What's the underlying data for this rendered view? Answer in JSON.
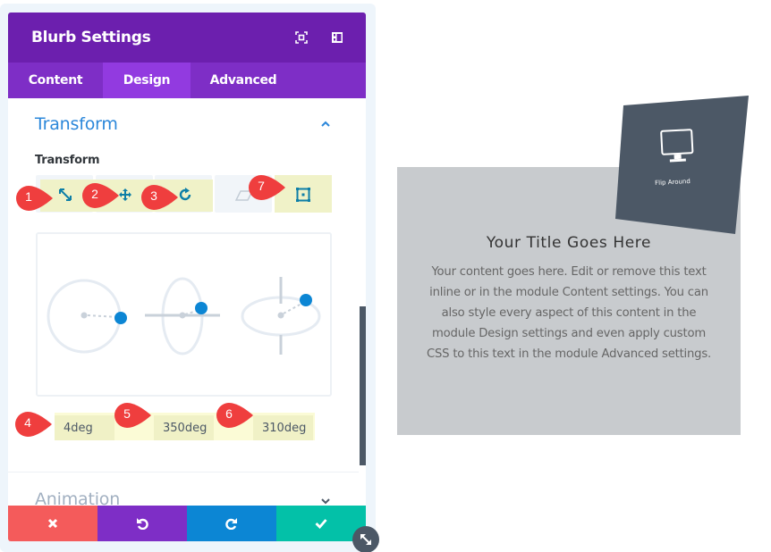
{
  "modal": {
    "title": "Blurb Settings",
    "header_icons": [
      "fullscreen-icon",
      "sidebar-layout-icon"
    ],
    "tabs": [
      {
        "label": "Content",
        "active": false
      },
      {
        "label": "Design",
        "active": true
      },
      {
        "label": "Advanced",
        "active": false
      }
    ],
    "section": {
      "title": "Transform",
      "expanded": true,
      "field_label": "Transform",
      "transform_types": [
        {
          "name": "scale",
          "icon": "scale-arrows-icon",
          "active": true
        },
        {
          "name": "translate",
          "icon": "move-arrows-icon",
          "active": true
        },
        {
          "name": "rotate",
          "icon": "rotate-icon",
          "active": true
        },
        {
          "name": "skew",
          "icon": "skew-icon",
          "active": false
        },
        {
          "name": "origin",
          "icon": "transform-origin-icon",
          "active": true
        }
      ],
      "rotation_values": {
        "x": "4deg",
        "y": "350deg",
        "z": "310deg"
      }
    },
    "collapsed_section": {
      "title": "Animation",
      "expanded": false
    },
    "footer_buttons": [
      {
        "name": "discard",
        "icon": "close-icon",
        "color": "#f45b5b"
      },
      {
        "name": "undo",
        "icon": "undo-icon",
        "color": "#7e2ec6"
      },
      {
        "name": "redo",
        "icon": "redo-icon",
        "color": "#0c86d4"
      },
      {
        "name": "save",
        "icon": "check-icon",
        "color": "#03c1a8"
      }
    ]
  },
  "callouts": [
    "1",
    "2",
    "3",
    "4",
    "5",
    "6",
    "7"
  ],
  "blurb": {
    "icon": "monitor-icon",
    "icon_caption": "Flip Around",
    "title": "Your Title Goes Here",
    "body": "Your content goes here. Edit or remove this text inline or in the module Content settings. You can also style every aspect of this content in the module Design settings and even apply custom CSS to this text in the module Advanced settings."
  },
  "colors": {
    "header": "#6c1fae",
    "tabs": "#7e2ec6",
    "active_tab": "#923ae0",
    "accent_blue": "#2b87da",
    "callout_red": "#ef3e3e",
    "highlight_yellow": "#f0f2c8",
    "card_dark": "#4c5866",
    "blurb_bg": "#c8cbce"
  }
}
